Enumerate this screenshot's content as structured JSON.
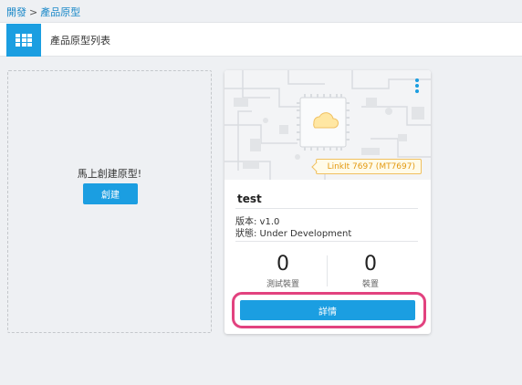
{
  "breadcrumb": {
    "items": [
      "開發",
      "產品原型"
    ],
    "separator": ">"
  },
  "header": {
    "title": "產品原型列表",
    "icon": "grid-icon"
  },
  "create": {
    "prompt": "馬上創建原型!",
    "button_label": "創建"
  },
  "card": {
    "name": "test",
    "chip": "LinkIt 7697 (MT7697)",
    "version_line": "版本: v1.0",
    "status_line": "狀態: Under Development",
    "test_devices": {
      "value": "0",
      "label": "測試裝置"
    },
    "devices": {
      "value": "0",
      "label": "裝置"
    },
    "detail_button": "詳情"
  },
  "colors": {
    "accent": "#1b9ee1",
    "highlight": "#e2427f",
    "chip": "#e39a12"
  }
}
